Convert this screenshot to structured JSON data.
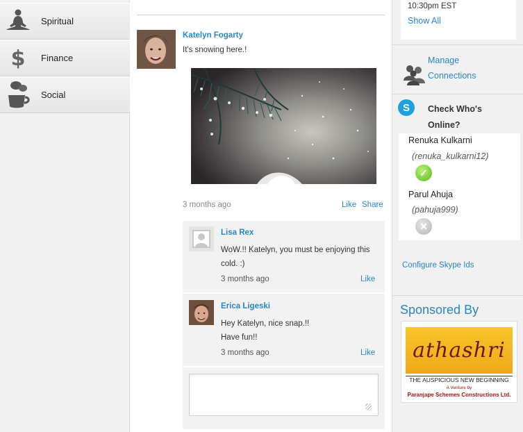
{
  "sidebar": {
    "items": [
      {
        "label": "Spiritual",
        "icon": "meditation-icon"
      },
      {
        "label": "Finance",
        "icon": "dollar-icon"
      },
      {
        "label": "Social",
        "icon": "coffee-chat-icon"
      }
    ]
  },
  "post": {
    "author": "Katelyn Fogarty",
    "text": "It's snowing here.!",
    "time": "3 months ago",
    "like_label": "Like",
    "share_label": "Share"
  },
  "comments": [
    {
      "name": "Lisa Rex",
      "text": "WoW.!! Katelyn, you must be enjoying this cold. :)",
      "time": "3 months ago",
      "like_label": "Like"
    },
    {
      "name": "Erica Ligeski",
      "text_line1": "Hey Katelyn, nice snap.!!",
      "text_line2": "Have fun!!",
      "time": "3 months ago",
      "like_label": "Like"
    }
  ],
  "rightcol": {
    "event_time": "10:30pm EST",
    "show_all": "Show All",
    "manage_connections": "Manage Connections",
    "skype_title": "Check Who's Online?",
    "users": [
      {
        "name": "Renuka Kulkarni",
        "handle": "(renuka_kulkarni12)",
        "status": "online"
      },
      {
        "name": "Parul Ahuja",
        "handle": "(pahuja999)",
        "status": "offline"
      }
    ],
    "configure_label": "Configure Skype Ids",
    "sponsored_title": "Sponsored By",
    "ad": {
      "logo_text": "athashri",
      "tagline": "THE AUSPICIOUS NEW BEGINNING",
      "venture_line": "A Venture by",
      "company": "Paranjape Schemes Constructions Ltd."
    }
  },
  "colors": {
    "link": "#2a86c4",
    "sidebar_bg": "#f1f1f1",
    "online": "#58b81e",
    "skype": "#1ea1dd"
  }
}
